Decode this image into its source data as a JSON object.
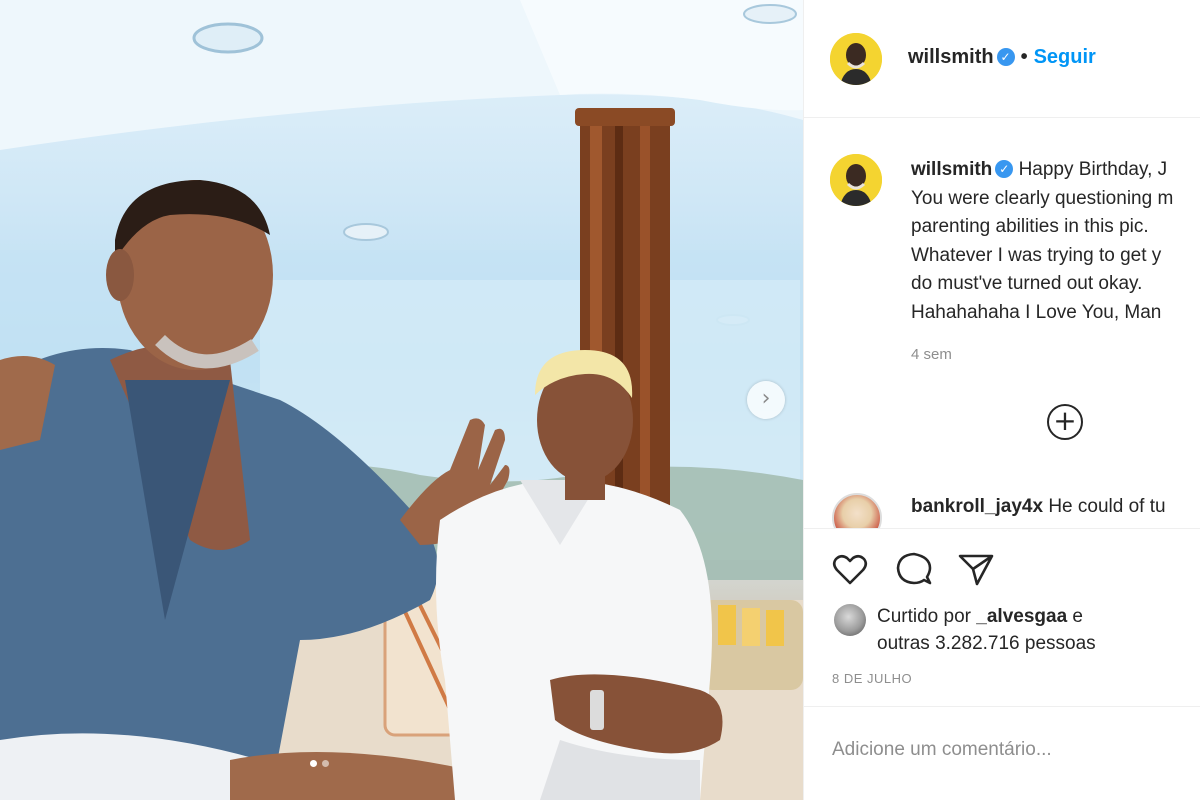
{
  "post": {
    "username": "willsmith",
    "follow_label": "Seguir",
    "separator": "•",
    "verified_glyph": "✓",
    "caption_lines": [
      "Happy Birthday, J",
      "You were clearly questioning m",
      "parenting abilities in this pic.",
      "Whatever I was trying to get y",
      "do must've turned out okay.",
      "Hahahahaha I Love You, Man"
    ],
    "time_ago": "4 sem",
    "load_more_glyph": "+",
    "comments": [
      {
        "username": "bankroll_jay4x",
        "text": "He could of tu"
      }
    ],
    "liked_by_prefix": "Curtido por",
    "liked_by_user": "_alvesgaa",
    "liked_by_suffix": "e",
    "liked_by_others": "outras 3.282.716 pessoas",
    "date": "8 DE JULHO",
    "comment_placeholder": "Adicione um comentário..."
  },
  "carousel": {
    "next_glyph": "›",
    "dots": 2,
    "active_dot": 0
  },
  "icons": {
    "like": "heart-icon",
    "comment": "comment-bubble-icon",
    "share": "paper-plane-icon"
  },
  "colors": {
    "accent": "#0095f6",
    "verified": "#3897f0",
    "avatar_bg": "#f4d430",
    "text": "#262626",
    "muted": "#8e8e8e"
  }
}
